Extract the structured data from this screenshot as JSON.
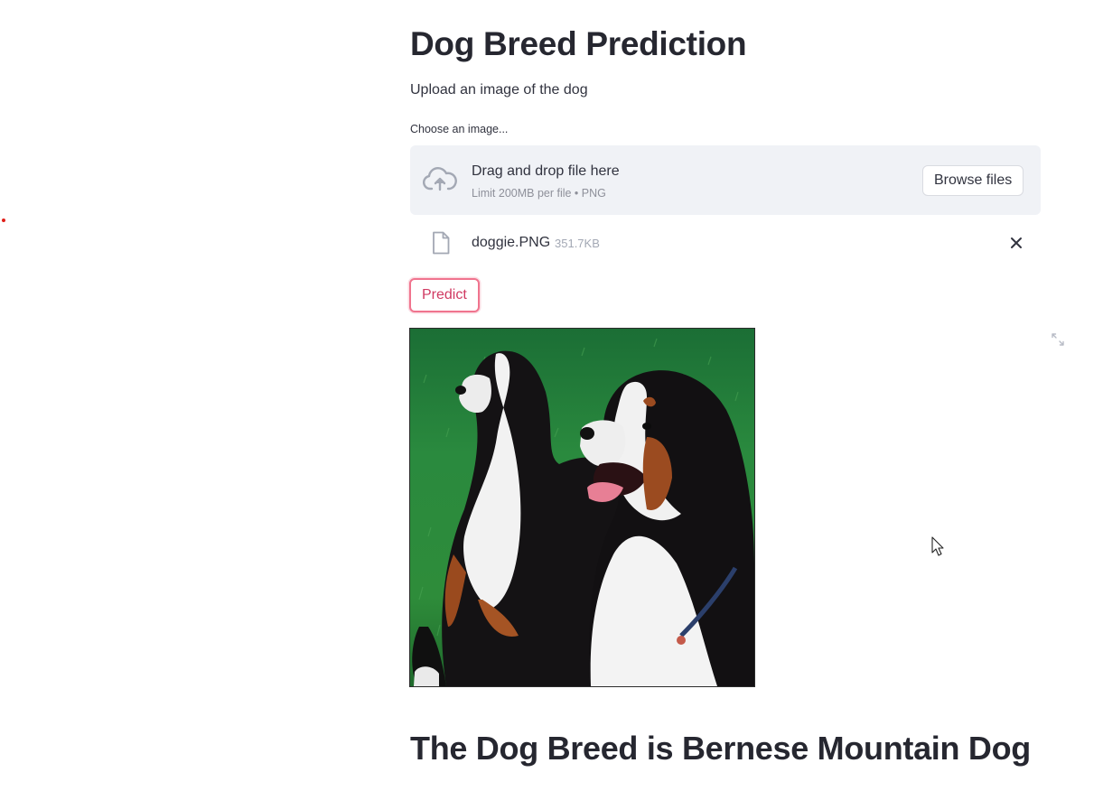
{
  "app": {
    "title": "Dog Breed Prediction",
    "subtitle": "Upload an image of the dog"
  },
  "uploader": {
    "label": "Choose an image...",
    "drop_title": "Drag and drop file here",
    "drop_limit": "Limit 200MB per file • PNG",
    "browse_label": "Browse files",
    "file": {
      "name": "doggie.PNG",
      "size": "351.7KB"
    }
  },
  "actions": {
    "predict_label": "Predict"
  },
  "result": {
    "text": "The Dog Breed is Bernese Mountain Dog"
  },
  "icons": {
    "upload": "cloud-upload-icon",
    "file": "file-icon",
    "remove": "close-icon",
    "fullscreen": "fullscreen-icon",
    "cursor": "mouse-pointer-icon"
  },
  "colors": {
    "accent": "#f0748e",
    "accent_text": "#d03a62",
    "dropzone_bg": "#f0f2f6",
    "text": "#262730"
  }
}
